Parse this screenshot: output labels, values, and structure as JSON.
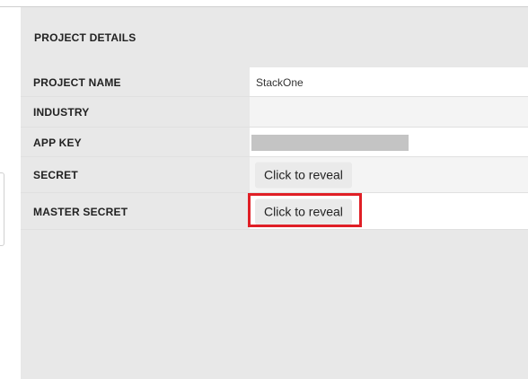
{
  "panel": {
    "title": "PROJECT DETAILS"
  },
  "rows": [
    {
      "label": "PROJECT NAME",
      "value": "StackOne"
    },
    {
      "label": "INDUSTRY",
      "value": ""
    },
    {
      "label": "APP KEY",
      "value_masked": true
    },
    {
      "label": "SECRET",
      "button_label": "Click to reveal"
    },
    {
      "label": "MASTER SECRET",
      "button_label": "Click to reveal",
      "highlighted": true
    }
  ],
  "colors": {
    "panel_bg": "#e8e8e8",
    "highlight": "#e01f26",
    "mask": "#c4c4c4"
  }
}
